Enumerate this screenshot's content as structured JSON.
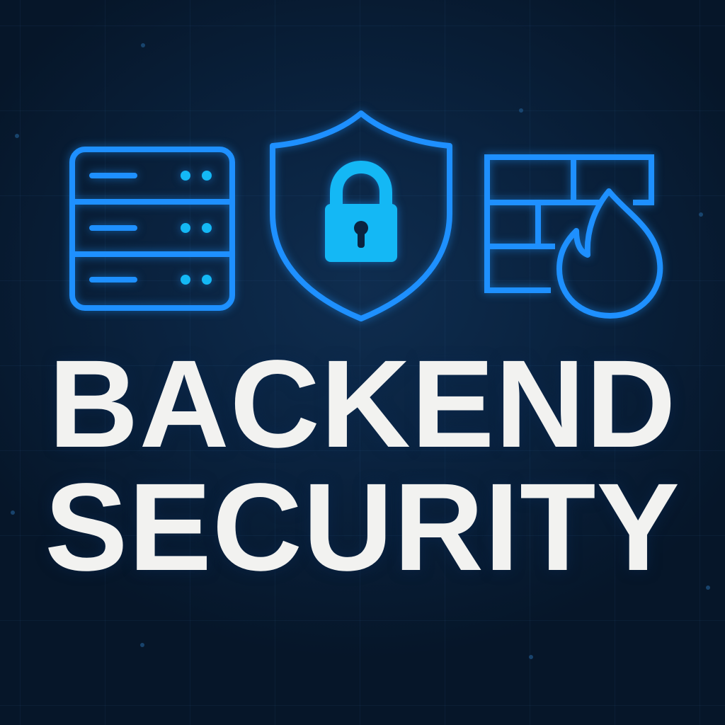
{
  "title": {
    "line1": "BACKEND",
    "line2": "SECURITY"
  },
  "icons": [
    "server-icon",
    "shield-lock-icon",
    "firewall-flame-icon"
  ],
  "colors": {
    "background": "#07182c",
    "accent_blue": "#1e90ff",
    "accent_cyan": "#14b8f5",
    "title_text": "#f2f2f0"
  }
}
